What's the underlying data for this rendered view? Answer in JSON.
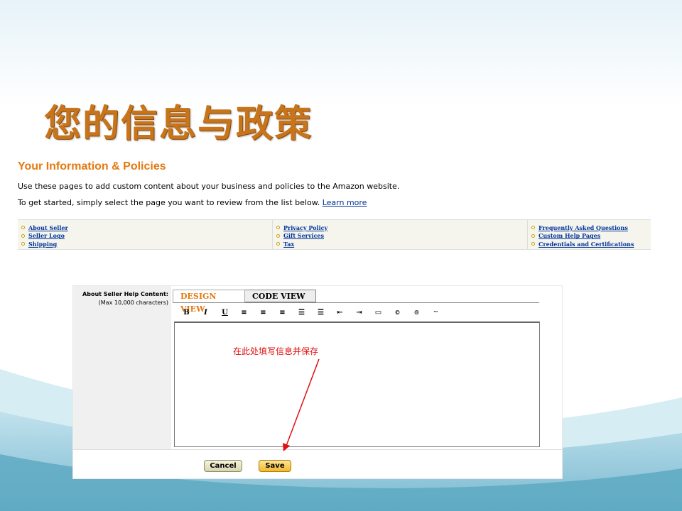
{
  "slide": {
    "title": "您的信息与政策"
  },
  "policies_page": {
    "heading": "Your Information & Policies",
    "intro": "Use these pages to add custom content about your business and policies to the Amazon website.",
    "instruction": "To get started, simply select the page you want to review from the list below.",
    "learn_more": "Learn more",
    "columns": [
      {
        "links": [
          "About Seller",
          "Seller Logo",
          "Shipping"
        ]
      },
      {
        "links": [
          "Privacy Policy",
          "Gift Services",
          "Tax"
        ]
      },
      {
        "links": [
          "Frequently Asked Questions",
          "Custom Help Pages",
          "Credentials and Certifications"
        ]
      }
    ]
  },
  "editor_page": {
    "field_label": "About Seller Help Content:",
    "field_note": "(Max 10,000 characters)",
    "tabs": [
      "DESIGN VIEW",
      "CODE VIEW"
    ],
    "active_tab": "DESIGN VIEW",
    "toolbar": [
      {
        "icon": "bold-icon",
        "glyph": "B"
      },
      {
        "icon": "italic-icon",
        "glyph": "I"
      },
      {
        "icon": "underline-icon",
        "glyph": "U"
      },
      {
        "icon": "align-left-icon",
        "glyph": "≡"
      },
      {
        "icon": "align-center-icon",
        "glyph": "≡"
      },
      {
        "icon": "align-right-icon",
        "glyph": "≡"
      },
      {
        "icon": "ordered-list-icon",
        "glyph": "☰"
      },
      {
        "icon": "unordered-list-icon",
        "glyph": "☰"
      },
      {
        "icon": "outdent-icon",
        "glyph": "⇤"
      },
      {
        "icon": "indent-icon",
        "glyph": "⇥"
      },
      {
        "icon": "table-icon",
        "glyph": "▭"
      },
      {
        "icon": "copyright-icon",
        "glyph": "©"
      },
      {
        "icon": "registered-icon",
        "glyph": "®"
      },
      {
        "icon": "trademark-icon",
        "glyph": "™"
      }
    ],
    "annotation": "在此处填写信息并保存",
    "cancel_label": "Cancel",
    "save_label": "Save"
  },
  "colors": {
    "title": "#c8741b",
    "heading": "#e47911",
    "link": "#003399",
    "annotation": "#e01010"
  }
}
